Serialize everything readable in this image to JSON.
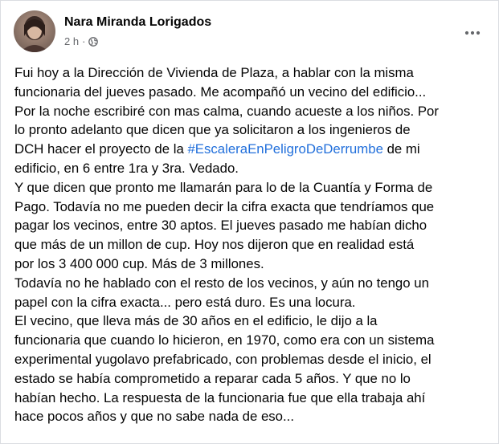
{
  "post": {
    "author": "Nara Miranda Lorigados",
    "timestamp": "2 h",
    "separator": "·",
    "privacy_icon": "globe-icon",
    "more_icon": "more-horizontal-icon",
    "hashtag": "#EscaleraEnPeligroDeDerrumbe",
    "lines": [
      "Fui hoy a la Dirección de Vivienda de Plaza, a hablar con la misma",
      "funcionaria del jueves pasado. Me acompañó un vecino del edificio...",
      "Por la noche escribiré con mas calma, cuando acueste a los niños. Por",
      "lo pronto adelanto que dicen que ya solicitaron a los ingenieros de",
      "",
      "edificio, en 6 entre 1ra y 3ra. Vedado.",
      "Y que dicen que pronto me llamarán para lo de la Cuantía y Forma de",
      "Pago. Todavía no me pueden decir la cifra exacta que tendríamos que",
      "pagar los vecinos, entre 30 aptos. El jueves  pasado me habían dicho",
      "que más de un millon de cup. Hoy nos dijeron que en realidad está",
      "por los 3 400 000 cup. Más de 3 millones.",
      "Todavía no he hablado con el resto de los vecinos, y aún no tengo un",
      "papel con la cifra exacta... pero está duro. Es una locura.",
      "El vecino, que lleva más de 30 años en el edificio, le dijo a la",
      "funcionaria que cuando lo hicieron, en 1970, como era con un sistema",
      "experimental yugolavo prefabricado, con problemas desde el inicio, el",
      "estado se había comprometido a reparar cada 5 años. Y que no lo",
      "habían  hecho. La respuesta de la funcionaria fue que ella trabaja ahí",
      "hace pocos años y que no sabe nada de eso..."
    ],
    "hashtag_line": {
      "before": "DCH hacer el proyecto de la ",
      "after": " de mi"
    }
  },
  "colors": {
    "text": "#050505",
    "secondary_text": "#65676b",
    "link": "#216fdb",
    "border": "#dadde1",
    "background": "#ffffff"
  }
}
